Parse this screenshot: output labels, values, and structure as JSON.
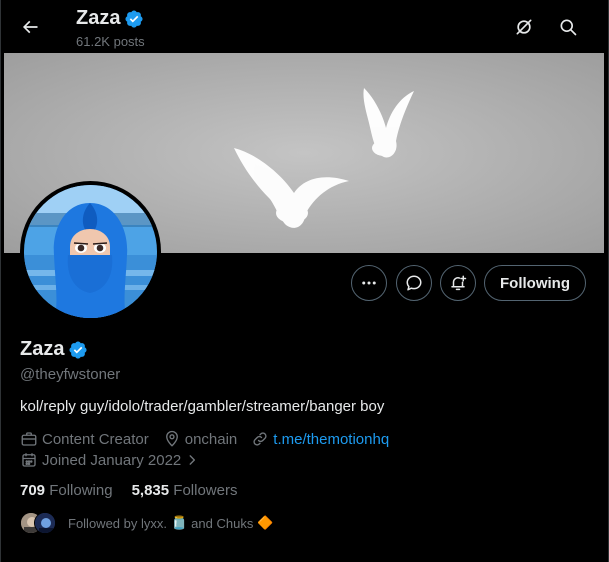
{
  "header": {
    "name": "Zaza",
    "posts": "61.2K posts"
  },
  "actions": {
    "following_label": "Following"
  },
  "profile": {
    "name": "Zaza",
    "handle": "@theyfwstoner",
    "bio": "kol/reply guy/idolo/trader/gambler/streamer/banger boy",
    "category": "Content Creator",
    "location": "onchain",
    "website": "t.me/themotionhq",
    "joined": "Joined January 2022"
  },
  "stats": {
    "following_count": "709",
    "following_label": "Following",
    "followers_count": "5,835",
    "followers_label": "Followers"
  },
  "followed_by": {
    "prefix": "Followed by lyxx.",
    "emoji1": "🫙",
    "connector": "and Chuks",
    "emoji2": "🔶"
  },
  "colors": {
    "background": "#000000",
    "accent": "#1d9bf0",
    "secondary_text": "#71767b",
    "primary_text": "#e7e9ea",
    "border": "#536471"
  }
}
